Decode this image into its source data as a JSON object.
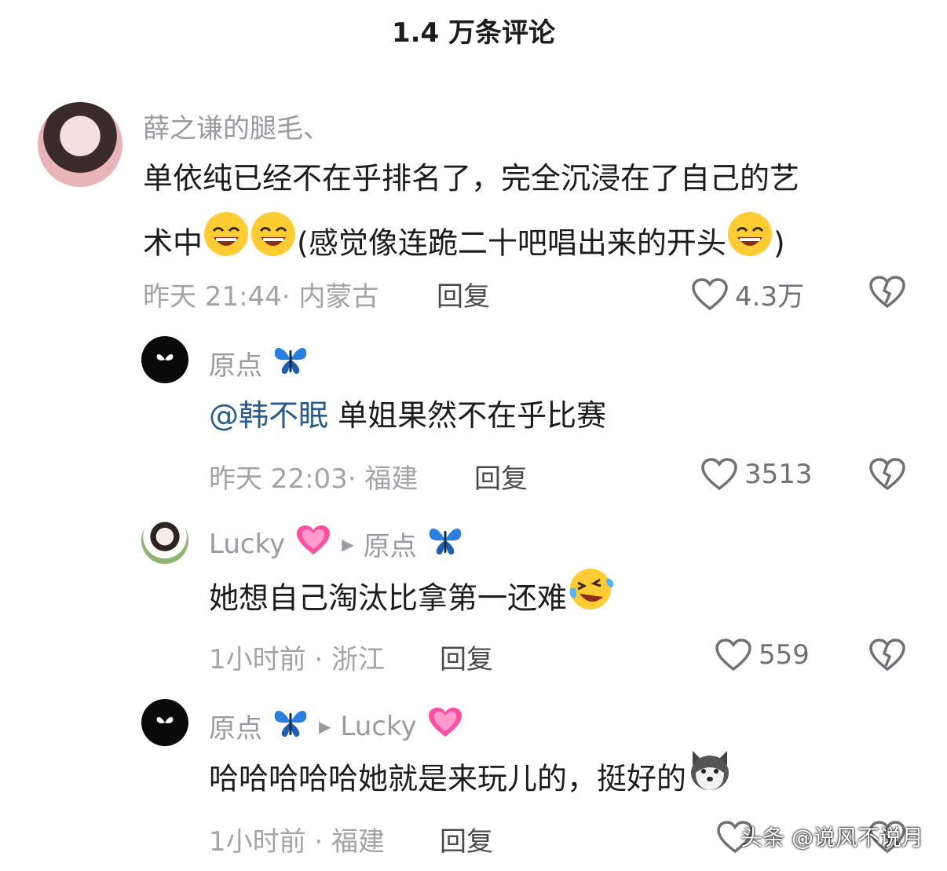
{
  "header": {
    "title": "1.4 万条评论"
  },
  "comment1": {
    "user": "薛之谦的腿毛、",
    "text_line1": "单依纯已经不在乎排名了，完全沉浸在了自己的艺",
    "text_line2_a": "术中",
    "text_line2_b": "(感觉像连跪二十吧唱出来的开头",
    "text_line2_c": ")",
    "time": "昨天 21:44· 内蒙古",
    "reply_label": "回复",
    "likes": "4.3万"
  },
  "reply1": {
    "user": "原点",
    "mention": "@韩不眠",
    "text": " 单姐果然不在乎比赛",
    "time": "昨天 22:03· 福建",
    "reply_label": "回复",
    "likes": "3513"
  },
  "reply2": {
    "user": "Lucky",
    "reply_to": "原点",
    "text": "她想自己淘汰比拿第一还难",
    "time": "1小时前 · 浙江",
    "reply_label": "回复",
    "likes": "559"
  },
  "reply3": {
    "user": "原点",
    "reply_to": "Lucky",
    "text": "哈哈哈哈哈她就是来玩儿的，挺好的",
    "time": "1小时前 · 福建",
    "reply_label": "回复"
  },
  "watermark": "头条 @说风不说月",
  "colors": {
    "mention": "#2b5a8c",
    "meta": "#a3a3a8",
    "name": "#9a9aa0"
  },
  "icons": [
    "heart-outline-icon",
    "broken-heart-icon",
    "butterfly-emoji",
    "pink-heart-emoji",
    "grin-emoji",
    "laughing-tears-emoji",
    "husky-emoji"
  ]
}
